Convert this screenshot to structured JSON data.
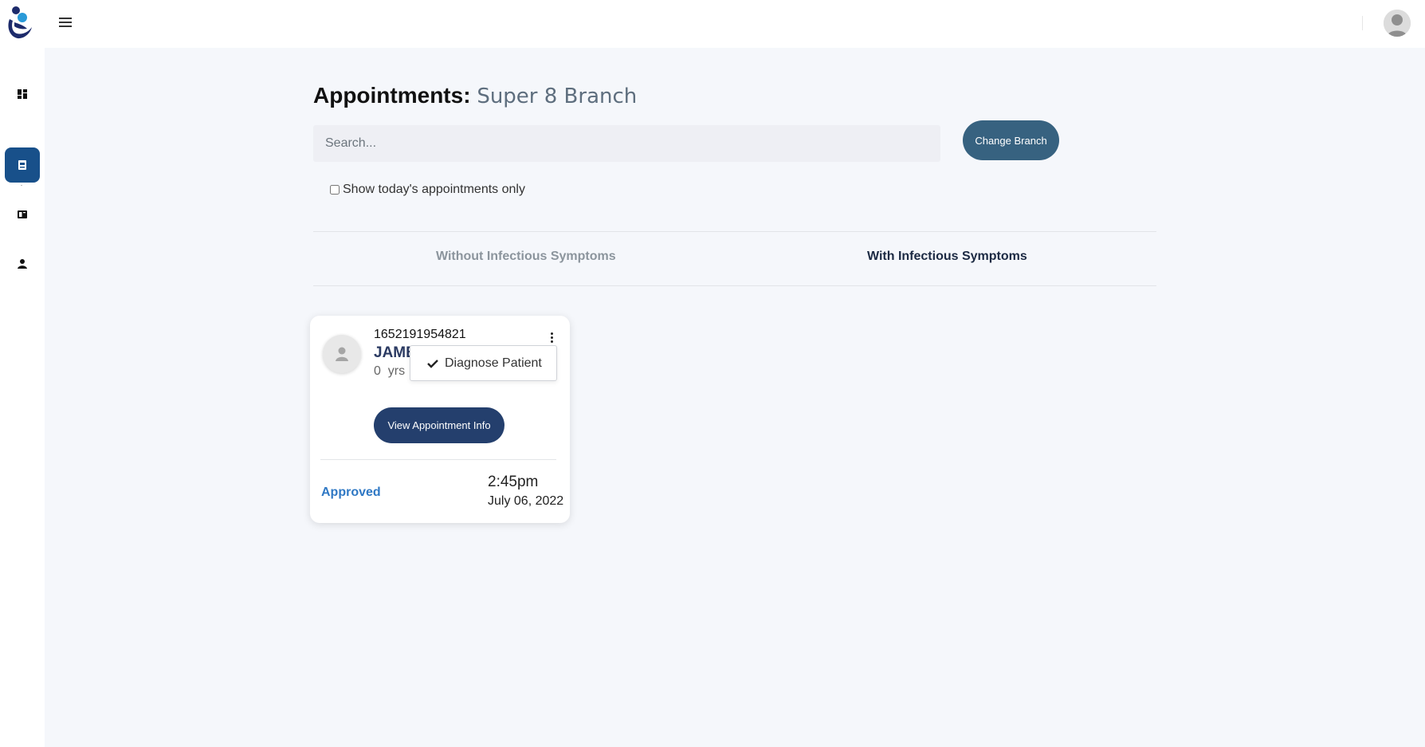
{
  "header": {
    "logo_icon": "stethoscope-person-logo",
    "menu_icon": "hamburger-icon",
    "avatar_icon": "user-avatar"
  },
  "sidebar": {
    "items": [
      {
        "icon": "dashboard-icon",
        "active": false
      },
      {
        "icon": "appointment-icon",
        "active": true
      },
      {
        "icon": "book-icon",
        "active": false
      },
      {
        "icon": "person-icon",
        "active": false
      }
    ],
    "active_color": "#18508a"
  },
  "page": {
    "title_prefix": "Appointments:",
    "branch_name": "Super 8 Branch"
  },
  "search": {
    "placeholder": "Search...",
    "value": ""
  },
  "change_branch_label": "Change Branch",
  "today_filter": {
    "label": "Show today's appointments only",
    "checked": false
  },
  "tabs": [
    {
      "label": "Without Infectious Symptoms",
      "active": false
    },
    {
      "label": "With Infectious Symptoms",
      "active": true
    }
  ],
  "appointments": [
    {
      "patient_id": "1652191954821",
      "name": "JAME",
      "age_value": "0",
      "age_unit": "yrs",
      "menu_option": "Diagnose Patient",
      "view_label": "View Appointment Info",
      "status": "Approved",
      "time": "2:45pm",
      "date": "July 06, 2022"
    }
  ],
  "colors": {
    "primary_button": "#243f6d",
    "branch_button": "#376280",
    "status_approved": "#2f78c4"
  }
}
